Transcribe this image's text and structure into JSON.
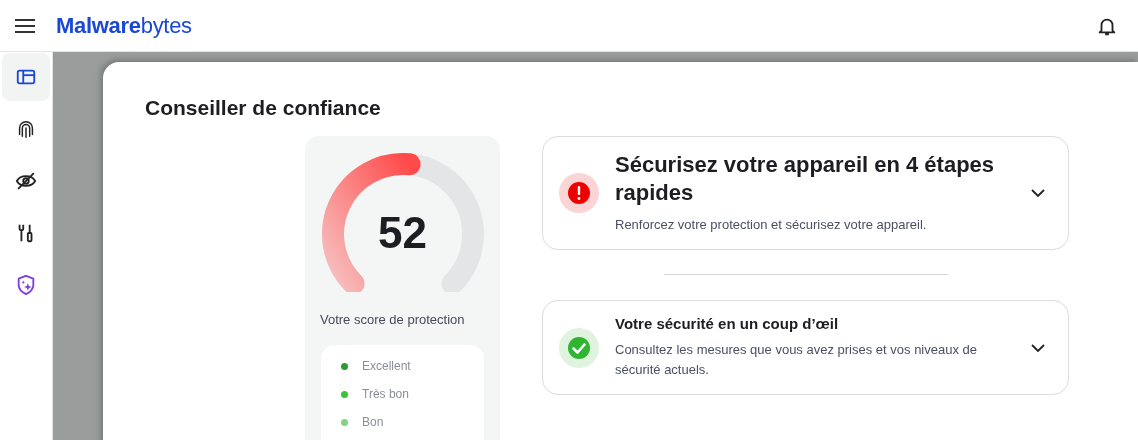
{
  "header": {
    "brand": "**Malware**bytes"
  },
  "sidebar": {
    "items": [
      {
        "kind": "dashboard",
        "selected": true
      },
      {
        "kind": "fingerprint",
        "selected": false
      },
      {
        "kind": "eye-off",
        "selected": false
      },
      {
        "kind": "tools",
        "selected": false
      },
      {
        "kind": "shield",
        "selected": false
      }
    ]
  },
  "page": {
    "title": "Conseiller de confiance"
  },
  "score": {
    "value": "52",
    "level": 0.52,
    "label": "Votre score de protection",
    "legend": [
      {
        "label": "Excellent",
        "color": "#2e9a2e"
      },
      {
        "label": "Très bon",
        "color": "#3cc13c"
      },
      {
        "label": "Bon",
        "color": "#7fd67f"
      }
    ]
  },
  "cards": [
    {
      "kind": "warning",
      "title": "Sécurisez votre appareil en 4 étapes rapides",
      "description": "Renforcez votre protection et sécurisez votre appareil.",
      "expanded": false
    },
    {
      "kind": "ok",
      "title": "Votre sécurité en un coup d’œil",
      "description": "Consultez les mesures que vous avez prises et vos niveaux de sécurité actuels.",
      "expanded": false
    }
  ]
}
